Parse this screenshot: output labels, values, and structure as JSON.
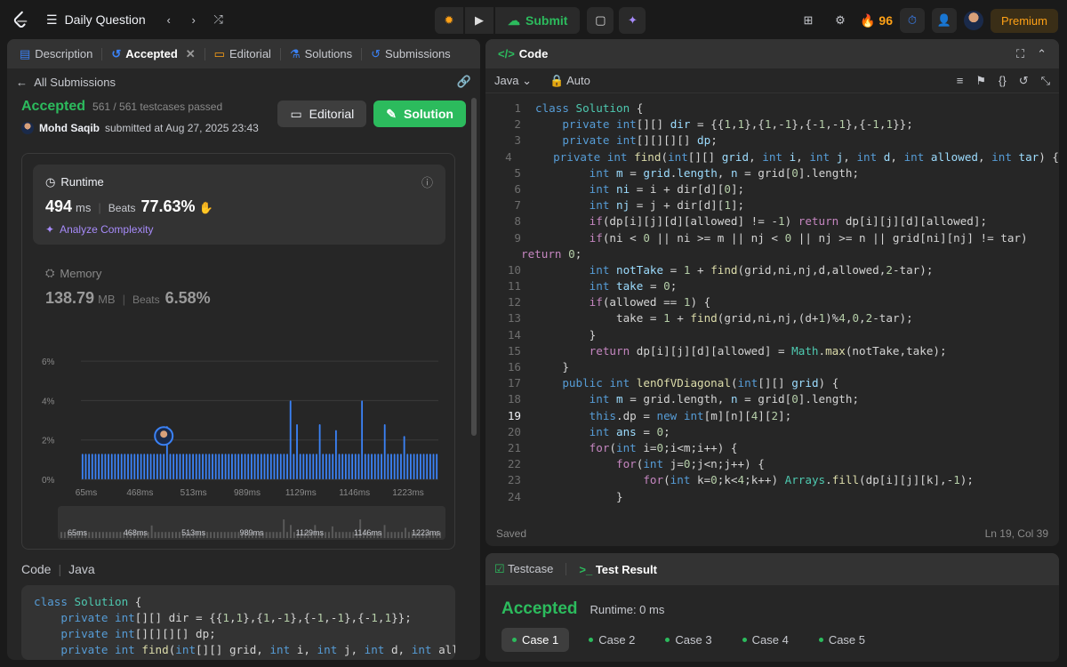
{
  "nav": {
    "problem_list": "Daily Question",
    "submit_label": "Submit",
    "streak": "96",
    "premium": "Premium"
  },
  "left": {
    "tabs": [
      {
        "label": "Description",
        "icon": "description-icon"
      },
      {
        "label": "Accepted",
        "icon": "history-icon"
      },
      {
        "label": "Editorial",
        "icon": "book-icon"
      },
      {
        "label": "Solutions",
        "icon": "flask-icon"
      },
      {
        "label": "Submissions",
        "icon": "history-icon"
      }
    ],
    "back_label": "All Submissions",
    "status": "Accepted",
    "passed": "561 / 561 testcases passed",
    "user": "Mohd Saqib",
    "submitted": "submitted at Aug 27, 2025 23:43",
    "editorial_btn": "Editorial",
    "solution_btn": "Solution",
    "runtime": {
      "title": "Runtime",
      "value": "494",
      "unit": "ms",
      "beats_label": "Beats",
      "beats": "77.63%",
      "analyze": "Analyze Complexity"
    },
    "memory": {
      "title": "Memory",
      "value": "138.79",
      "unit": "MB",
      "beats_label": "Beats",
      "beats": "6.58%"
    },
    "code_label": "Code",
    "lang": "Java",
    "snippet": "class Solution {\n    private int[][] dir = {{1,1},{1,-1},{-1,-1},{-1,1}};\n    private int[][][][] dp;\n    private int find(int[][] grid, int i, int j, int d, int allo"
  },
  "chart_data": {
    "type": "bar",
    "ylabel": "",
    "yticks": [
      "6%",
      "4%",
      "2%",
      "0%"
    ],
    "ylim": [
      0,
      6.5
    ],
    "xticks": [
      "65ms",
      "468ms",
      "513ms",
      "989ms",
      "1129ms",
      "1146ms",
      "1223ms"
    ],
    "values": [
      1.3,
      1.3,
      1.3,
      1.3,
      1.3,
      1.3,
      1.3,
      1.3,
      1.3,
      1.3,
      1.3,
      1.3,
      1.3,
      1.3,
      1.3,
      1.3,
      1.3,
      1.3,
      1.3,
      1.3,
      1.3,
      1.3,
      1.3,
      1.3,
      1.3,
      1.3,
      2.7,
      1.3,
      1.3,
      1.3,
      1.3,
      1.3,
      1.3,
      1.3,
      1.3,
      1.3,
      1.3,
      1.3,
      1.3,
      1.3,
      1.3,
      1.3,
      1.3,
      1.3,
      1.3,
      1.3,
      1.3,
      1.3,
      1.3,
      1.3,
      1.3,
      1.3,
      1.3,
      1.3,
      1.3,
      1.3,
      1.3,
      1.3,
      1.3,
      1.3,
      1.3,
      1.3,
      1.3,
      1.3,
      4.0,
      1.3,
      2.8,
      1.3,
      1.3,
      1.3,
      1.3,
      1.3,
      1.3,
      2.8,
      1.3,
      1.3,
      1.3,
      1.3,
      2.5,
      1.3,
      1.3,
      1.3,
      1.3,
      1.3,
      1.3,
      1.3,
      4.0,
      1.3,
      1.3,
      1.3,
      1.3,
      1.3,
      1.3,
      2.8,
      1.3,
      1.3,
      1.3,
      1.3,
      1.3,
      2.2,
      1.3,
      1.3,
      1.3,
      1.3,
      1.3,
      1.3,
      1.3,
      1.3,
      1.3,
      1.3
    ],
    "highlight_index": 25,
    "grid": true,
    "color": "#3b82f6"
  },
  "editor": {
    "title": "Code",
    "lang": "Java",
    "mode": "Auto",
    "status_left": "Saved",
    "status_right": "Ln 19, Col 39",
    "current_line": 19,
    "lines": [
      {
        "n": "1",
        "h": "<span class='kw'>class</span> <span class='ty'>Solution</span> {"
      },
      {
        "n": "2",
        "h": "    <span class='kw'>private</span> <span class='kw'>int</span>[][] <span class='var'>dir</span> = {{<span class='num'>1</span>,<span class='num'>1</span>},{<span class='num'>1</span>,-<span class='num'>1</span>},{-<span class='num'>1</span>,-<span class='num'>1</span>},{-<span class='num'>1</span>,<span class='num'>1</span>}};"
      },
      {
        "n": "3",
        "h": "    <span class='kw'>private</span> <span class='kw'>int</span>[][][][] <span class='var'>dp</span>;"
      },
      {
        "n": "4",
        "h": "    <span class='kw'>private</span> <span class='kw'>int</span> <span class='fn'>find</span>(<span class='kw'>int</span>[][] <span class='var'>grid</span>, <span class='kw'>int</span> <span class='var'>i</span>, <span class='kw'>int</span> <span class='var'>j</span>, <span class='kw'>int</span> <span class='var'>d</span>, <span class='kw'>int</span> <span class='var'>allowed</span>, <span class='kw'>int</span> <span class='var'>tar</span>) {"
      },
      {
        "n": "5",
        "h": "        <span class='kw'>int</span> <span class='var'>m</span> = <span class='var'>grid</span>.<span class='var'>length</span>, <span class='var'>n</span> = grid[<span class='num'>0</span>].length;"
      },
      {
        "n": "6",
        "h": "        <span class='kw'>int</span> <span class='var'>ni</span> = i + dir[d][<span class='num'>0</span>];"
      },
      {
        "n": "7",
        "h": "        <span class='kw'>int</span> <span class='var'>nj</span> = j + dir[d][<span class='num'>1</span>];"
      },
      {
        "n": "8",
        "h": "        <span class='ctl'>if</span>(dp[i][j][d][allowed] != -<span class='num'>1</span>) <span class='ctl'>return</span> dp[i][j][d][allowed];"
      },
      {
        "n": "9",
        "h": "        <span class='ctl'>if</span>(ni &lt; <span class='num'>0</span> || ni &gt;= m || nj &lt; <span class='num'>0</span> || nj &gt;= n || grid[ni][nj] != tar)"
      },
      {
        "n": "",
        "h": "<span class='ctl' style='margin-left:-16px'>return</span> <span class='num'>0</span>;"
      },
      {
        "n": "10",
        "h": "        <span class='kw'>int</span> <span class='var'>notTake</span> = <span class='num'>1</span> + <span class='fn'>find</span>(grid,ni,nj,d,allowed,<span class='num'>2</span>-tar);"
      },
      {
        "n": "11",
        "h": "        <span class='kw'>int</span> <span class='var'>take</span> = <span class='num'>0</span>;"
      },
      {
        "n": "12",
        "h": "        <span class='ctl'>if</span>(allowed == <span class='num'>1</span>) {"
      },
      {
        "n": "13",
        "h": "            take = <span class='num'>1</span> + <span class='fn'>find</span>(grid,ni,nj,(d+<span class='num'>1</span>)%<span class='num'>4</span>,<span class='num'>0</span>,<span class='num'>2</span>-tar);"
      },
      {
        "n": "14",
        "h": "        }"
      },
      {
        "n": "15",
        "h": "        <span class='ctl'>return</span> dp[i][j][d][allowed] = <span class='ty'>Math</span>.<span class='fn'>max</span>(notTake,take);"
      },
      {
        "n": "16",
        "h": "    }"
      },
      {
        "n": "17",
        "h": "    <span class='kw'>public</span> <span class='kw'>int</span> <span class='fn'>lenOfVDiagonal</span>(<span class='kw'>int</span>[][] <span class='var'>grid</span>) {"
      },
      {
        "n": "18",
        "h": "        <span class='kw'>int</span> <span class='var'>m</span> = grid.length, <span class='var'>n</span> = grid[<span class='num'>0</span>].length;"
      },
      {
        "n": "19",
        "h": "        <span class='kw'>this</span>.dp = <span class='kw'>new</span> <span class='kw'>int</span>[m][n][<span class='num'>4</span>][<span class='num'>2</span>];"
      },
      {
        "n": "20",
        "h": "        <span class='kw'>int</span> <span class='var'>ans</span> = <span class='num'>0</span>;"
      },
      {
        "n": "21",
        "h": "        <span class='ctl'>for</span>(<span class='kw'>int</span> i=<span class='num'>0</span>;i&lt;m;i++) {"
      },
      {
        "n": "22",
        "h": "            <span class='ctl'>for</span>(<span class='kw'>int</span> j=<span class='num'>0</span>;j&lt;n;j++) {"
      },
      {
        "n": "23",
        "h": "                <span class='ctl'>for</span>(<span class='kw'>int</span> k=<span class='num'>0</span>;k&lt;<span class='num'>4</span>;k++) <span class='ty'>Arrays</span>.<span class='fn'>fill</span>(dp[i][j][k],-<span class='num'>1</span>);"
      },
      {
        "n": "24",
        "h": "            }"
      }
    ]
  },
  "result": {
    "tab_testcase": "Testcase",
    "tab_result": "Test Result",
    "status": "Accepted",
    "runtime": "Runtime: 0 ms",
    "cases": [
      "Case 1",
      "Case 2",
      "Case 3",
      "Case 4",
      "Case 5"
    ]
  }
}
